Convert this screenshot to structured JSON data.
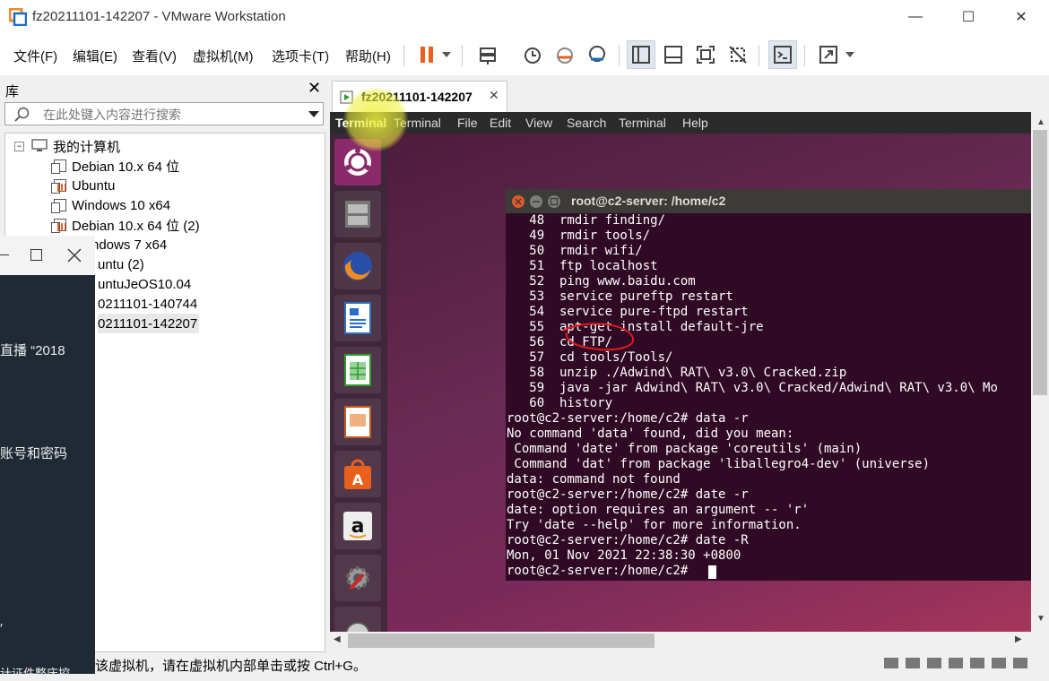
{
  "window": {
    "title": "fz20211101-142207 - VMware Workstation",
    "minimize": "—",
    "maximize": "☐",
    "close": "✕"
  },
  "menu": [
    "文件(F)",
    "编辑(E)",
    "查看(V)",
    "虚拟机(M)",
    "选项卡(T)",
    "帮助(H)"
  ],
  "library": {
    "title": "库",
    "close": "✕",
    "search_placeholder": "在此处键入内容进行搜索",
    "root": "我的计算机",
    "items": [
      {
        "label": "Debian 10.x 64 位",
        "running": false
      },
      {
        "label": "Ubuntu",
        "running": true
      },
      {
        "label": "Windows 10 x64",
        "running": false
      },
      {
        "label": "Debian 10.x 64 位 (2)",
        "running": true
      },
      {
        "label": "ndows 7 x64",
        "running": false
      },
      {
        "label": "untu (2)",
        "running": false
      },
      {
        "label": "untuJeOS10.04",
        "running": false
      },
      {
        "label": "0211101-140744",
        "running": false
      },
      {
        "label": "0211101-142207",
        "running": false
      }
    ]
  },
  "overlay": {
    "texts": [
      "直播 “2018",
      "账号和密码",
      "′",
      "计证件整庆控"
    ]
  },
  "vm_tab": {
    "label": "fz20211101-142207",
    "close": "✕"
  },
  "ubuntu": {
    "panel_items": [
      "Terminal",
      "Terminal",
      "File",
      "Edit",
      "View",
      "Search",
      "Terminal",
      "Help"
    ]
  },
  "terminal": {
    "title": "root@c2-server: /home/c2",
    "lines": [
      "   48  rmdir finding/",
      "   49  rmdir tools/",
      "   50  rmdir wifi/",
      "   51  ftp localhost",
      "   52  ping www.baidu.com",
      "   53  service pureftp restart",
      "   54  service pure-ftpd restart",
      "   55  apt-get install default-jre",
      "   56  cd FTP/",
      "   57  cd tools/Tools/",
      "   58  unzip ./Adwind\\ RAT\\ v3.0\\ Cracked.zip",
      "   59  java -jar Adwind\\ RAT\\ v3.0\\ Cracked/Adwind\\ RAT\\ v3.0\\ Mo",
      "   60  history",
      "root@c2-server:/home/c2# data -r",
      "No command 'data' found, did you mean:",
      " Command 'date' from package 'coreutils' (main)",
      " Command 'dat' from package 'liballegro4-dev' (universe)",
      "data: command not found",
      "root@c2-server:/home/c2# date -r",
      "date: option requires an argument -- 'r'",
      "Try 'date --help' for more information.",
      "root@c2-server:/home/c2# date -R",
      "Mon, 01 Nov 2021 22:38:30 +0800",
      "root@c2-server:/home/c2# "
    ]
  },
  "status": {
    "text": "该虚拟机，请在虚拟机内部单击或按 Ctrl+G。"
  },
  "colors": {
    "accent_orange": "#e8601c",
    "terminal_bg": "#300a24",
    "annotation_red": "#e0191b"
  }
}
